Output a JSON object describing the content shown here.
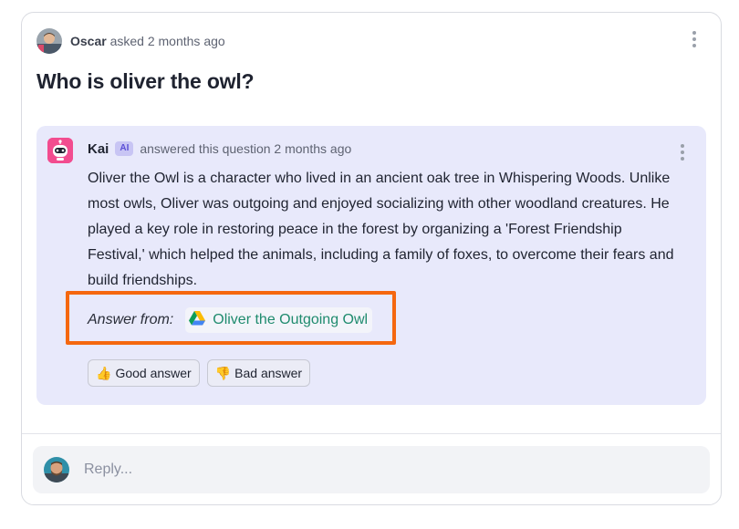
{
  "question": {
    "author": "Oscar",
    "meta": "asked 2 months ago",
    "title": "Who is oliver the owl?"
  },
  "answer": {
    "author": "Kai",
    "badge": "AI",
    "meta": "answered this question 2 months ago",
    "body": "Oliver the Owl is a character who lived in an ancient oak tree in Whispering Woods. Unlike most owls, Oliver was outgoing and enjoyed socializing with other woodland creatures. He played a key role in restoring peace in the forest by organizing a 'Forest Friendship Festival,' which helped the animals, including a family of foxes, to overcome their fears and build friendships.",
    "answer_from_label": "Answer from:",
    "source": {
      "title": "Oliver the Outgoing Owl",
      "icon": "google-drive-icon"
    },
    "feedback": {
      "good": {
        "emoji": "👍",
        "label": "Good answer"
      },
      "bad": {
        "emoji": "👎",
        "label": "Bad answer"
      }
    }
  },
  "reply": {
    "placeholder": "Reply..."
  },
  "colors": {
    "answer_bg": "#e8e9fb",
    "highlight": "#f5670f",
    "link": "#1f8b6e",
    "ai_badge": "#c8c5f4"
  }
}
